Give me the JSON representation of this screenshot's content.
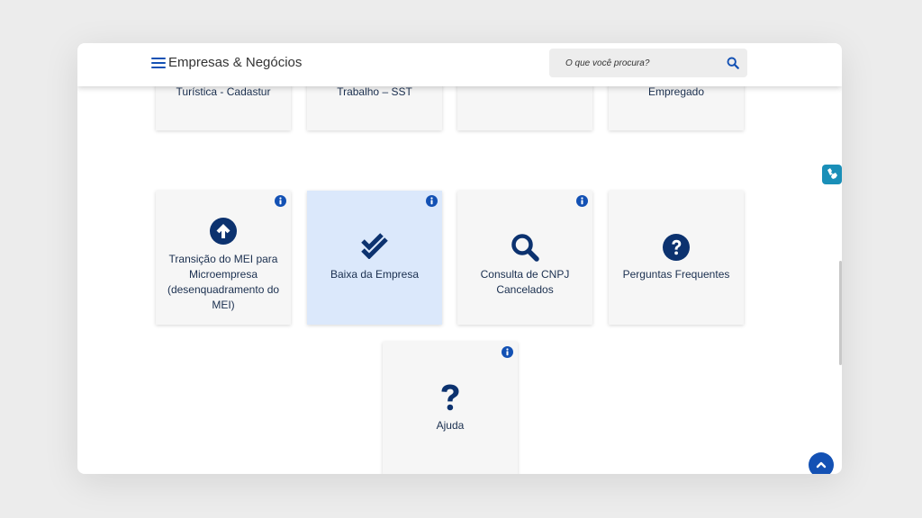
{
  "header": {
    "title": "Empresas & Negócios",
    "search_placeholder": "O que você procura?"
  },
  "top_row_cards": [
    {
      "label": "Turística - Cadastur"
    },
    {
      "label": "Trabalho – SST"
    },
    {
      "label": ""
    },
    {
      "label": "Empregado"
    }
  ],
  "cards": [
    {
      "label": "Transição do MEI para Microempresa (desenquadramento do MEI)",
      "icon": "arrow-up-circle-icon"
    },
    {
      "label": "Baixa da Empresa",
      "icon": "double-check-icon"
    },
    {
      "label": "Consulta de CNPJ Cancelados",
      "icon": "magnifier-icon"
    },
    {
      "label": "Perguntas Frequentes",
      "icon": "question-circle-icon"
    },
    {
      "label": "Ajuda",
      "icon": "question-mark-icon"
    }
  ],
  "colors": {
    "primary": "#1351b4",
    "icon_dark": "#0c326f",
    "card_bg": "#f6f6f6",
    "card_active_bg": "#dbe8fb"
  }
}
